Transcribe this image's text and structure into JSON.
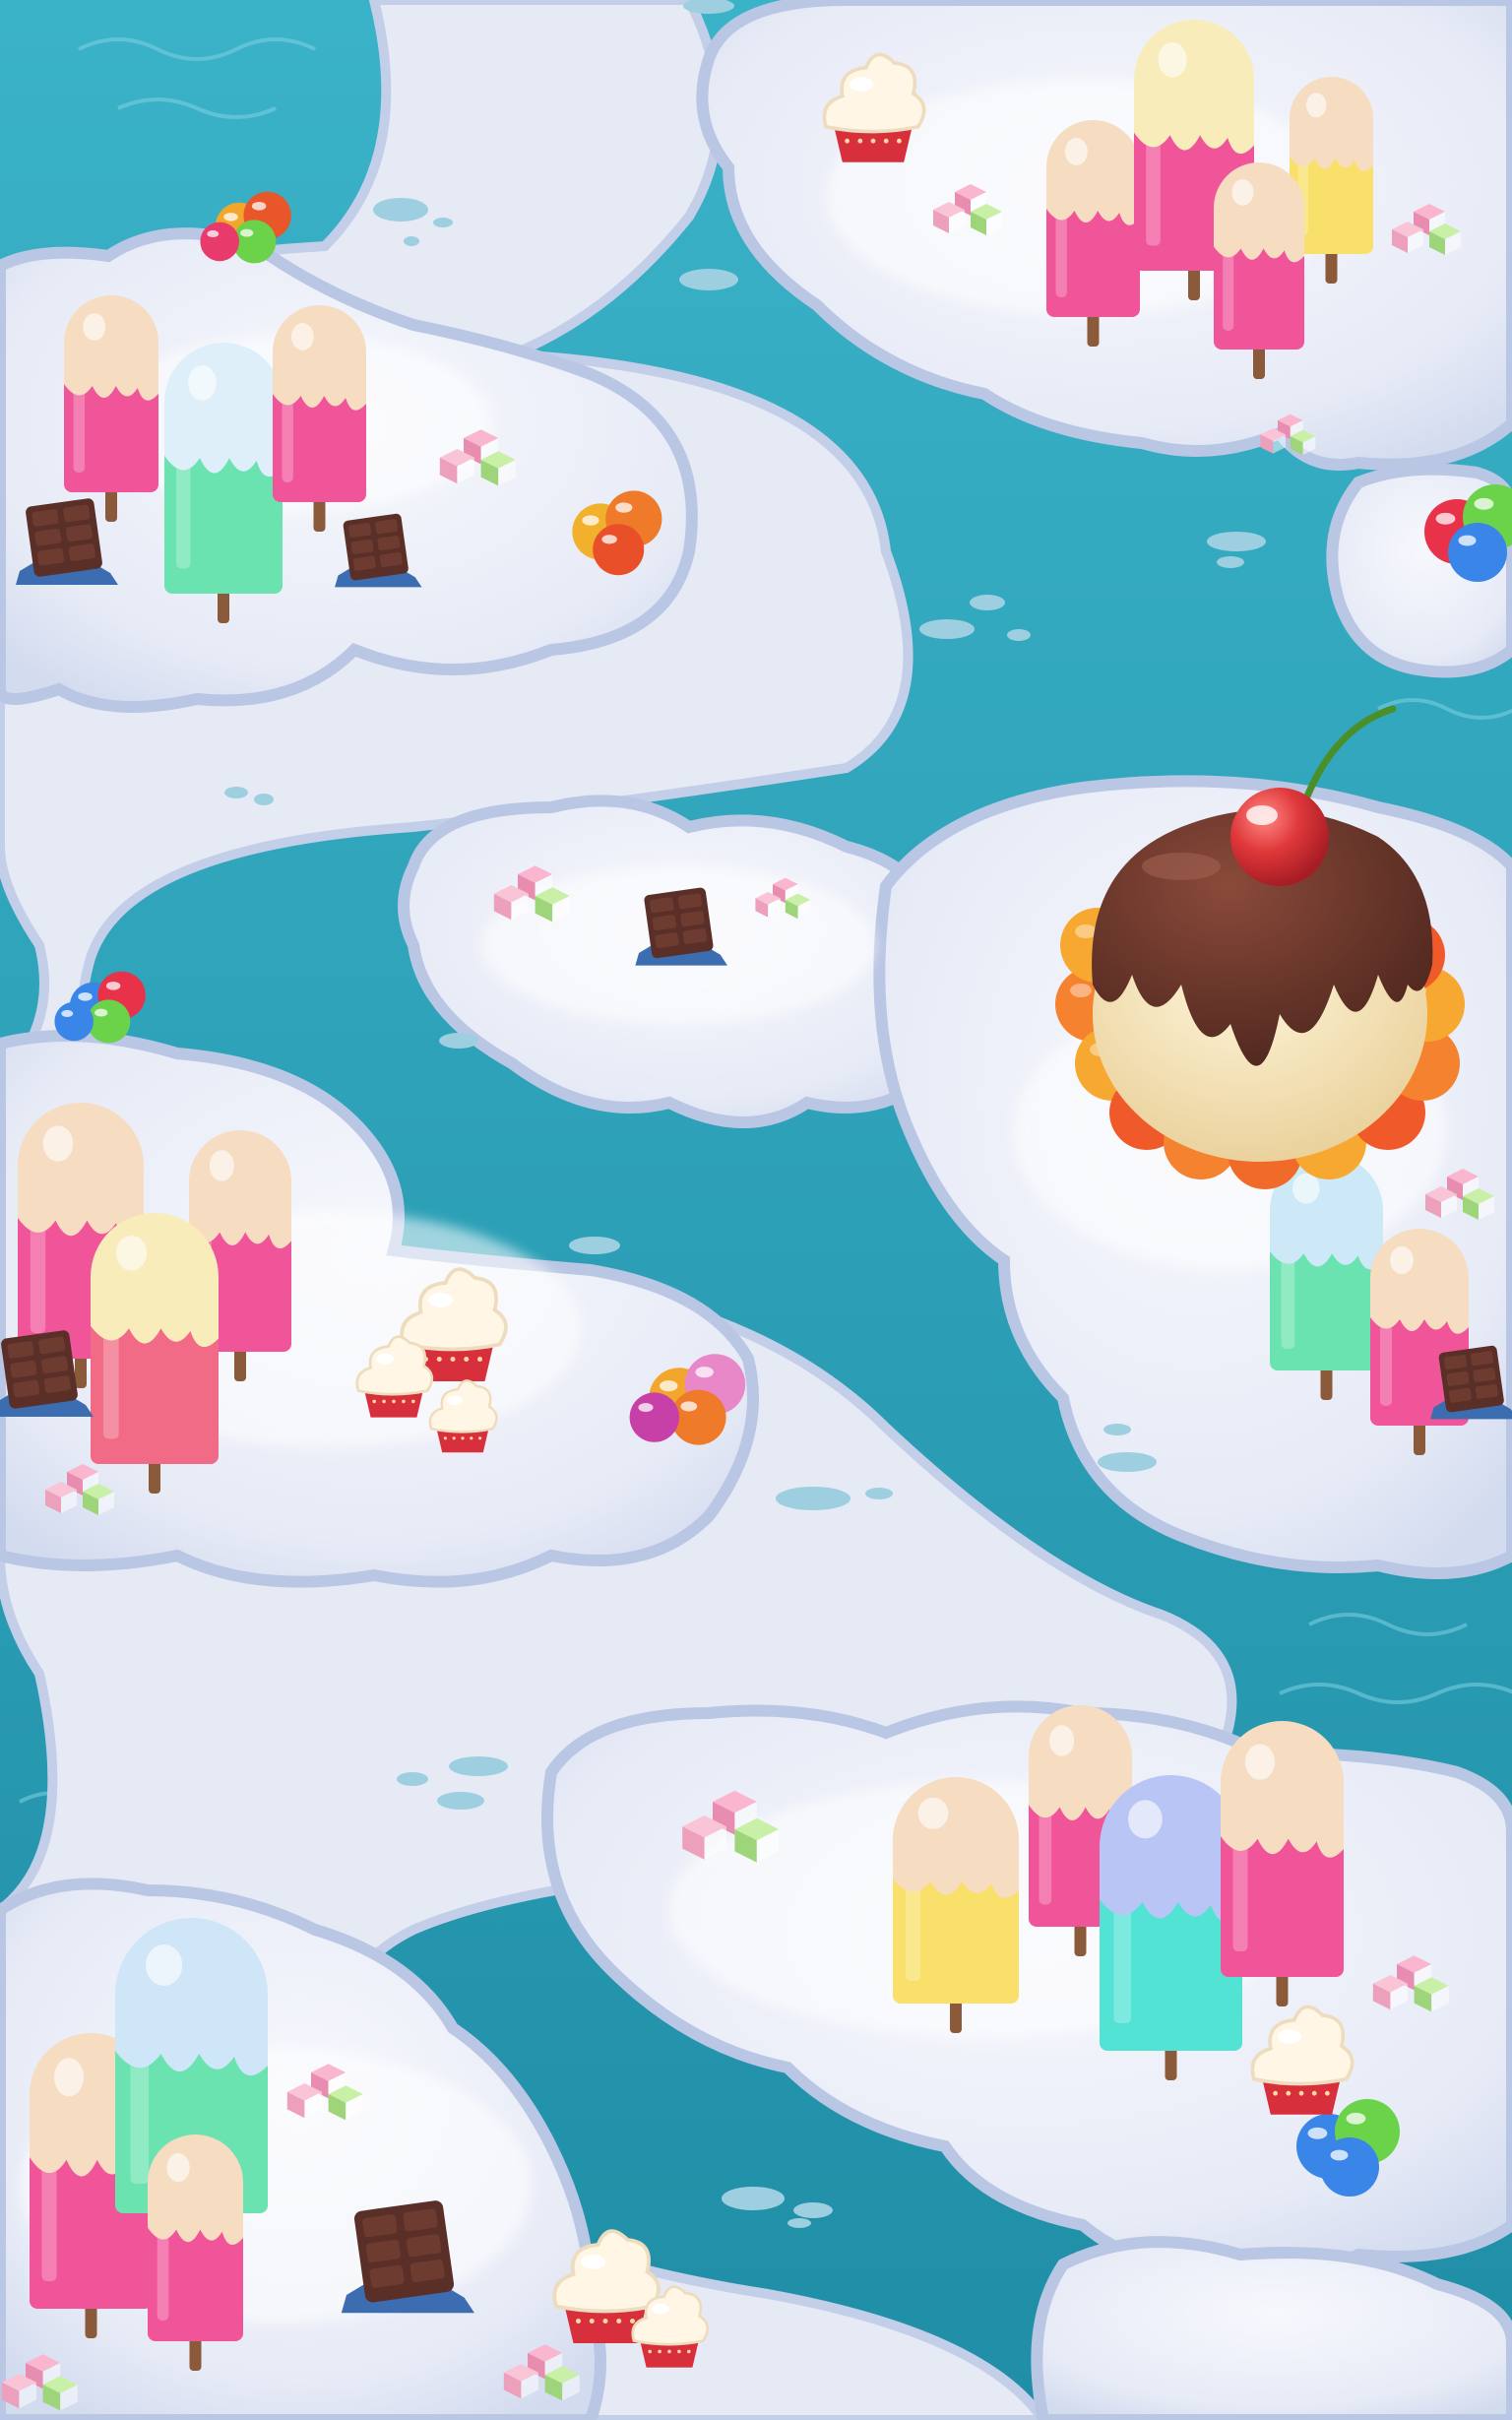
{
  "scene": {
    "kind": "game-map-background",
    "theme": "candy-snow",
    "colors": {
      "snow": "#ebeef8",
      "snow_shadow": "#c9d3ea",
      "snow_highlight": "#f7f8fd",
      "cloud_outline": "#b9c6e4",
      "water": "#2aa2bb",
      "water_deep": "#1d8aa3",
      "water_light": "#5cc3d6",
      "puddle": "#9dd0df",
      "chocolate": "#5a2f27",
      "cherry": "#e0383a",
      "cream": "#f6e4c6",
      "pink": "#f0559a",
      "mint": "#6be3b0",
      "yellow": "#f8e06a",
      "turquoise": "#52e3d4",
      "orange": "#f5822f"
    },
    "decorations": [
      {
        "type": "popsicle",
        "count": 18
      },
      {
        "type": "chocolate-bar",
        "count": 6
      },
      {
        "type": "candy-ball-cluster",
        "count": 7
      },
      {
        "type": "sugar-cube-cluster",
        "count": 12
      },
      {
        "type": "cupcake",
        "count": 7
      },
      {
        "type": "cherry-ice-cream-dome",
        "count": 1
      }
    ]
  }
}
